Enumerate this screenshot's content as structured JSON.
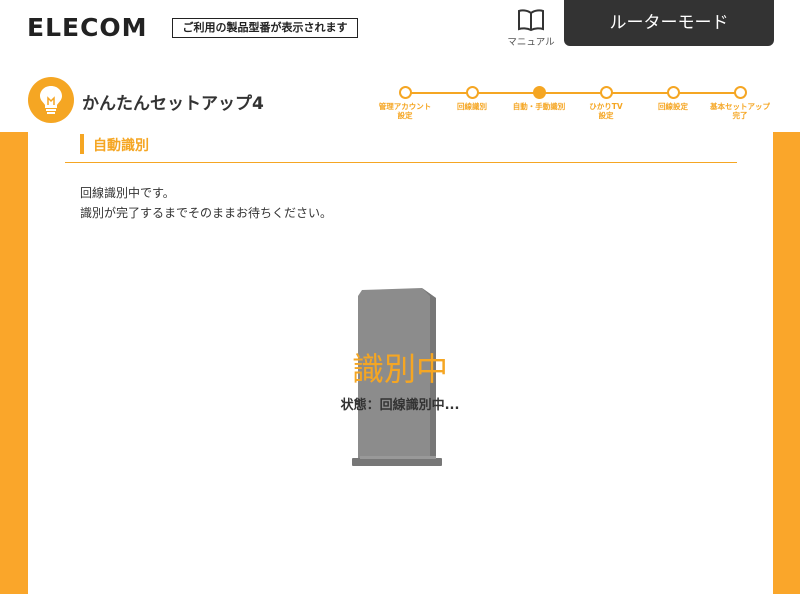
{
  "header": {
    "logo": "ELECOM",
    "model_notice": "ご利用の製品型番が表示されます",
    "manual_label": "マニュアル",
    "mode_button": "ルーターモード"
  },
  "setup": {
    "title": "かんたんセットアップ4",
    "steps": [
      {
        "label": "管理アカウント\n設定",
        "active": false
      },
      {
        "label": "回線識別",
        "active": false
      },
      {
        "label": "自動・手動識別",
        "active": true
      },
      {
        "label": "ひかりTV\n設定",
        "active": false
      },
      {
        "label": "回線設定",
        "active": false
      },
      {
        "label": "基本セットアップ\n完了",
        "active": false
      }
    ]
  },
  "section": {
    "title": "自動識別"
  },
  "messages": {
    "line1": "回線識別中です。",
    "line2": "識別が完了するまでそのままお待ちください。"
  },
  "status": {
    "big_text": "識別中",
    "state_text": "状態：回線識別中..."
  },
  "colors": {
    "accent": "#f5a623",
    "frame": "#faa62a",
    "dark": "#333333",
    "router": "#8c8c8c"
  }
}
